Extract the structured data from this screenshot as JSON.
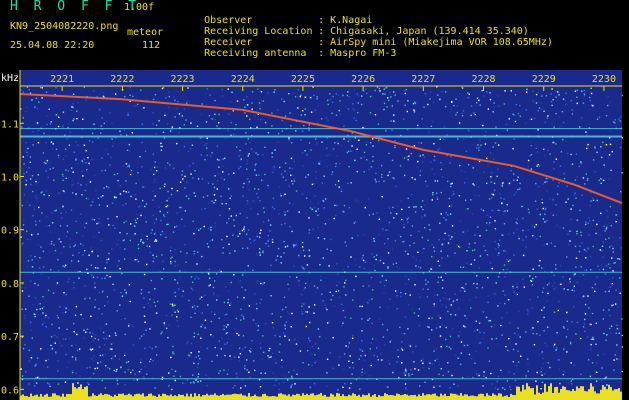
{
  "header": {
    "app_title": "H R O F F T",
    "version": "1.00f",
    "filename": "KN9_2504082220.png",
    "mode": "meteor",
    "datetime": "25.04.08 22:20",
    "count": "112"
  },
  "info": [
    {
      "label": "Observer",
      "value": ": K.Nagai"
    },
    {
      "label": "Receiving Location",
      "value": ": Chigasaki, Japan (139.414 35.340)"
    },
    {
      "label": "Receiver",
      "value": ": AirSpy mini (Miakejima VOR 108.65MHz)"
    },
    {
      "label": "Receiving antenna",
      "value": ": Maspro FM-3"
    }
  ],
  "chart_data": {
    "type": "heatmap",
    "ylabel": "kHz",
    "x_ticks": [
      "2221",
      "2222",
      "2223",
      "2224",
      "2225",
      "2226",
      "2227",
      "2228",
      "2229",
      "2230"
    ],
    "y_ticks": [
      "1.1",
      "1.0",
      "0.9",
      "0.8",
      "0.7",
      "0.6"
    ],
    "ylim": [
      0.58,
      1.17
    ],
    "constant_lines_khz": [
      1.09,
      1.075,
      0.82,
      0.62
    ],
    "drift_tracks": [
      {
        "x": [
          2220.3,
          2222,
          2224,
          2225.8,
          2227,
          2228.5,
          2229.5,
          2230.3
        ],
        "y": [
          1.155,
          1.145,
          1.125,
          1.085,
          1.05,
          1.02,
          0.985,
          0.95
        ]
      }
    ],
    "colors": {
      "background": "#1a2a8c",
      "noise_bright": "#ffffff",
      "signal": "#ff6020",
      "axis": "#e8e020",
      "constant_line": "#50d0e0"
    }
  }
}
